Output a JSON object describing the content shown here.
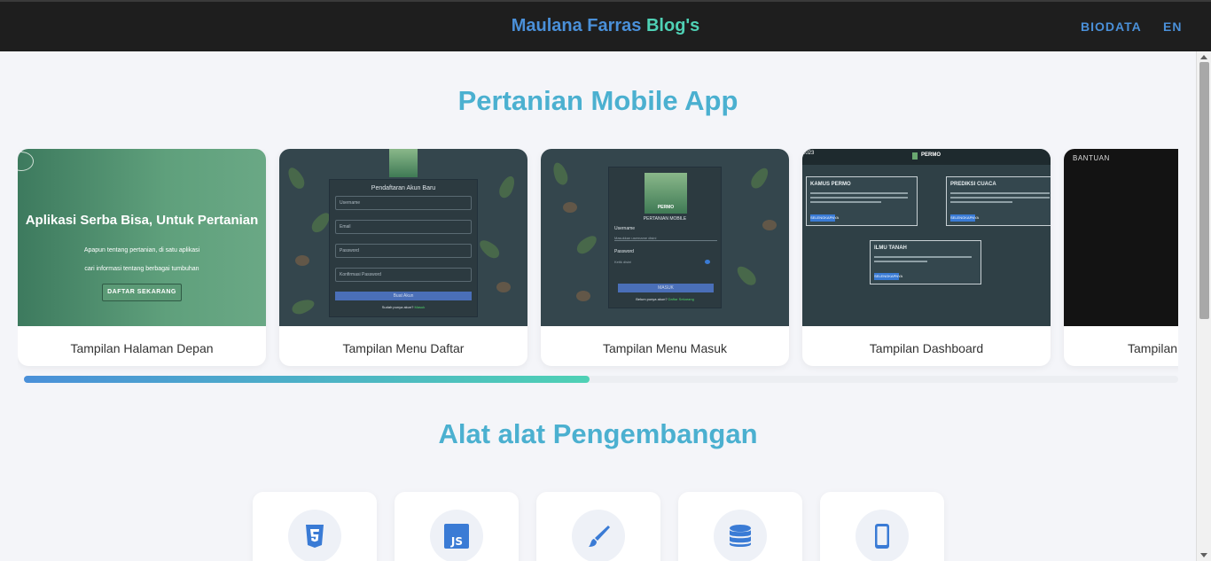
{
  "header": {
    "brand_part1": "Maulana Farras",
    "brand_part2": "Blog's",
    "nav": [
      {
        "label": "BIODATA"
      },
      {
        "label": "EN"
      }
    ]
  },
  "projects": {
    "title": "Pertanian Mobile App",
    "scroll_progress": 0.49,
    "cards": [
      {
        "label": "Tampilan Halaman Depan",
        "screen": {
          "heading": "Aplikasi Serba Bisa, Untuk Pertanian",
          "line1": "Apapun tentang pertanian, di satu aplikasi",
          "line2": "cari informasi tentang berbagai tumbuhan",
          "button": "DAFTAR SEKARANG"
        }
      },
      {
        "label": "Tampilan Menu Daftar",
        "screen": {
          "form_title": "Pendaftaran Akun Baru",
          "fields": [
            "Username",
            "Email",
            "Password",
            "Konfirmasi Password"
          ],
          "button": "Buat Akun",
          "footer_text": "Sudah punya akun?",
          "footer_link": "Masuk"
        }
      },
      {
        "label": "Tampilan Menu Masuk",
        "screen": {
          "logo_text": "PERMO",
          "app_name": "PERTANIAN MOBILE",
          "username_label": "Username",
          "username_placeholder": "Masukkan username disini",
          "password_label": "Password",
          "password_placeholder": "Ketik disini",
          "button": "MASUK",
          "footer_text": "Belum punya akun?",
          "footer_link": "Daftar Sekarang"
        }
      },
      {
        "label": "Tampilan Dashboard",
        "screen": {
          "brand": "PERMO",
          "year": "2023",
          "boxes": [
            "KAMUS PERMO",
            "PREDIKSI CUACA",
            "ILMU TANAH"
          ],
          "button": "SELENGKAPNYA"
        }
      },
      {
        "label": "Tampilan",
        "screen": {
          "title": "BANTUAN"
        }
      }
    ]
  },
  "tools": {
    "title": "Alat alat Pengembangan",
    "items": [
      {
        "icon": "html5-icon"
      },
      {
        "icon": "javascript-icon"
      },
      {
        "icon": "paintbrush-icon"
      },
      {
        "icon": "database-icon"
      },
      {
        "icon": "mobile-phone-icon"
      }
    ]
  },
  "colors": {
    "navbar_bg": "#1e1e1e",
    "brand_blue": "#4a90d9",
    "brand_teal": "#4fd1b5",
    "title_color": "#4bb0d0",
    "page_bg": "#f4f5f9"
  }
}
